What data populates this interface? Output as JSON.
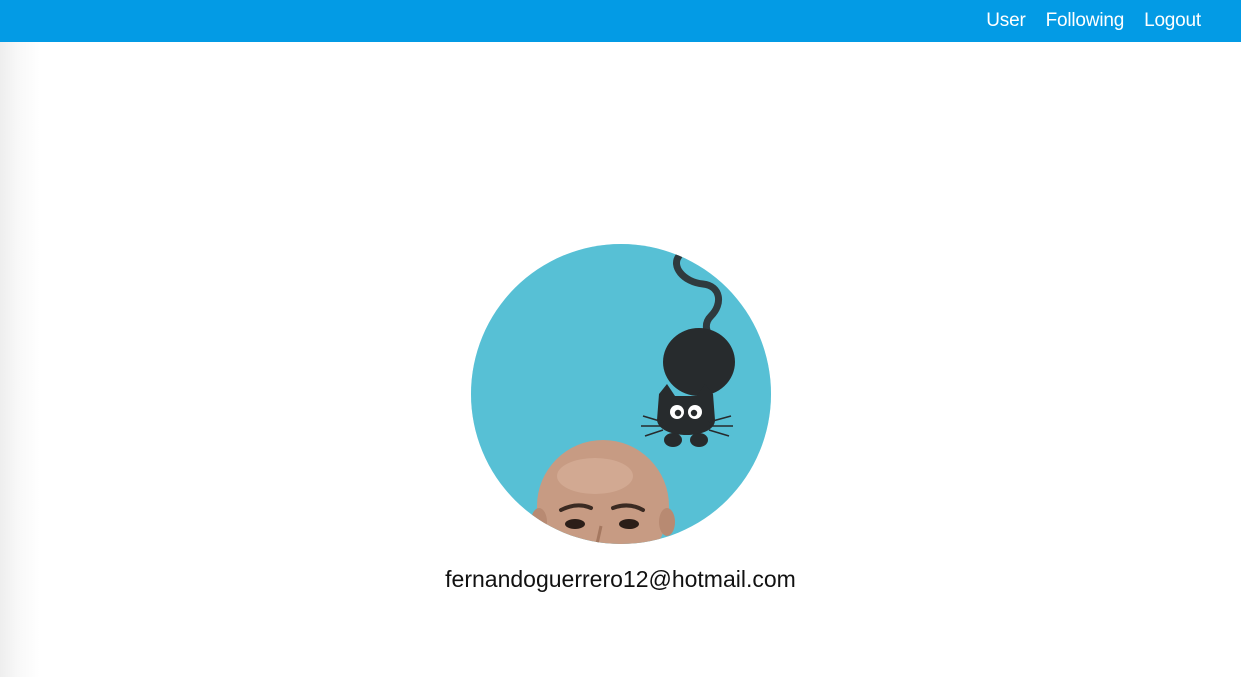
{
  "navbar": {
    "color": "#039be5",
    "links": [
      {
        "label": "User"
      },
      {
        "label": "Following"
      },
      {
        "label": "Logout"
      }
    ]
  },
  "profile": {
    "avatar_icon": "profile-photo",
    "avatar_background": "#5bc4d8",
    "email": "fernandoguerrero12@hotmail.com"
  }
}
